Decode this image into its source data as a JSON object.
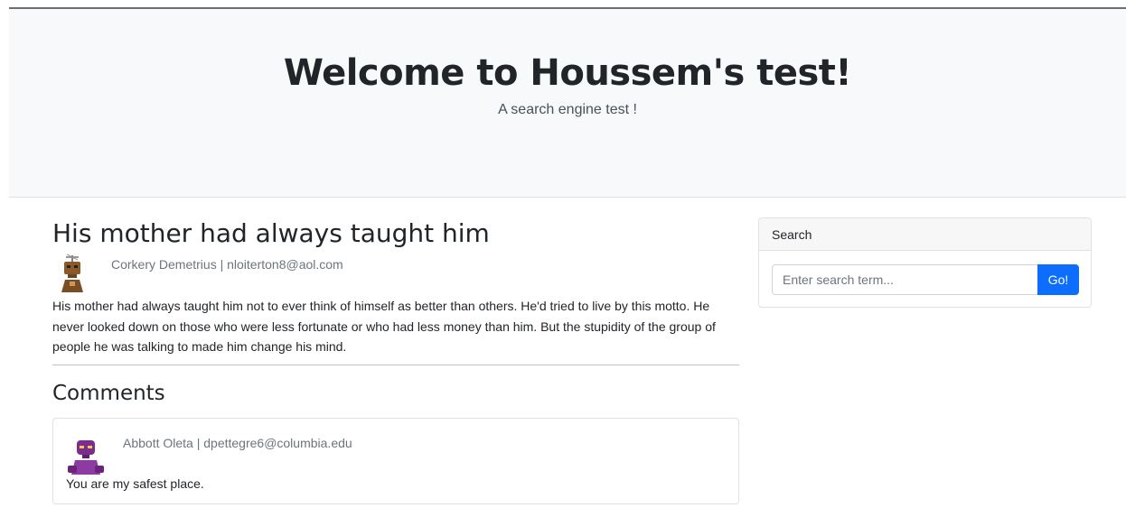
{
  "hero": {
    "title": "Welcome to Houssem's test!",
    "subtitle": "A search engine test !"
  },
  "post": {
    "title": "His mother had always taught him",
    "author_meta": "Corkery Demetrius | nloiterton8@aol.com",
    "body": "His mother had always taught him not to ever think of himself as better than others. He'd tried to live by this motto. He never looked down on those who were less fortunate or who had less money than him. But the stupidity of the group of people he was talking to made him change his mind."
  },
  "comments": {
    "heading": "Comments",
    "items": [
      {
        "author_meta": "Abbott Oleta | dpettegre6@columbia.edu",
        "text": "You are my safest place."
      }
    ]
  },
  "sidebar": {
    "search_header": "Search",
    "search_placeholder": "Enter search term...",
    "go_label": "Go!"
  },
  "colors": {
    "hero_bg": "#f8f9fa",
    "primary": "#0d6efd",
    "muted": "#6c757d"
  },
  "icons": {
    "post_avatar": "robot-avatar-brown",
    "comment_avatar": "robot-avatar-purple"
  }
}
